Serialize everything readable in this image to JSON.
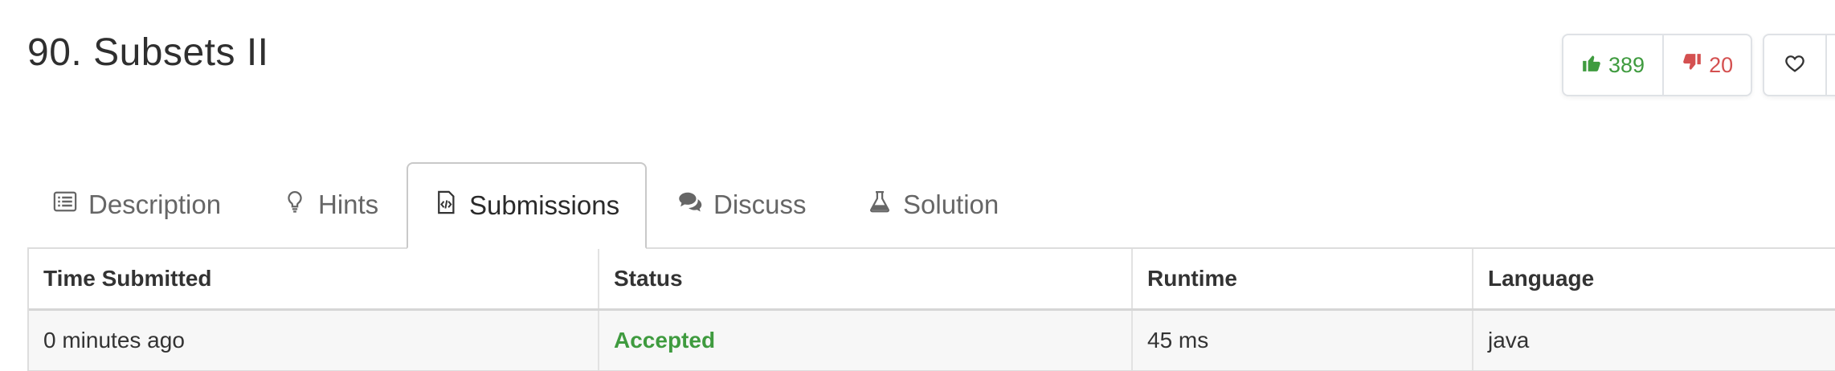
{
  "problem": {
    "title": "90. Subsets II"
  },
  "votes": {
    "likes": "389",
    "dislikes": "20",
    "like_color": "#3f9b3f",
    "dislike_color": "#d45050"
  },
  "tabs": [
    {
      "label": "Description",
      "icon": "list-icon"
    },
    {
      "label": "Hints",
      "icon": "lightbulb-icon"
    },
    {
      "label": "Submissions",
      "icon": "code-file-icon",
      "active": true
    },
    {
      "label": "Discuss",
      "icon": "comments-icon"
    },
    {
      "label": "Solution",
      "icon": "flask-icon"
    }
  ],
  "table": {
    "headers": [
      "Time Submitted",
      "Status",
      "Runtime",
      "Language"
    ],
    "rows": [
      {
        "time": "0 minutes ago",
        "status": "Accepted",
        "runtime": "45 ms",
        "language": "java"
      }
    ]
  }
}
